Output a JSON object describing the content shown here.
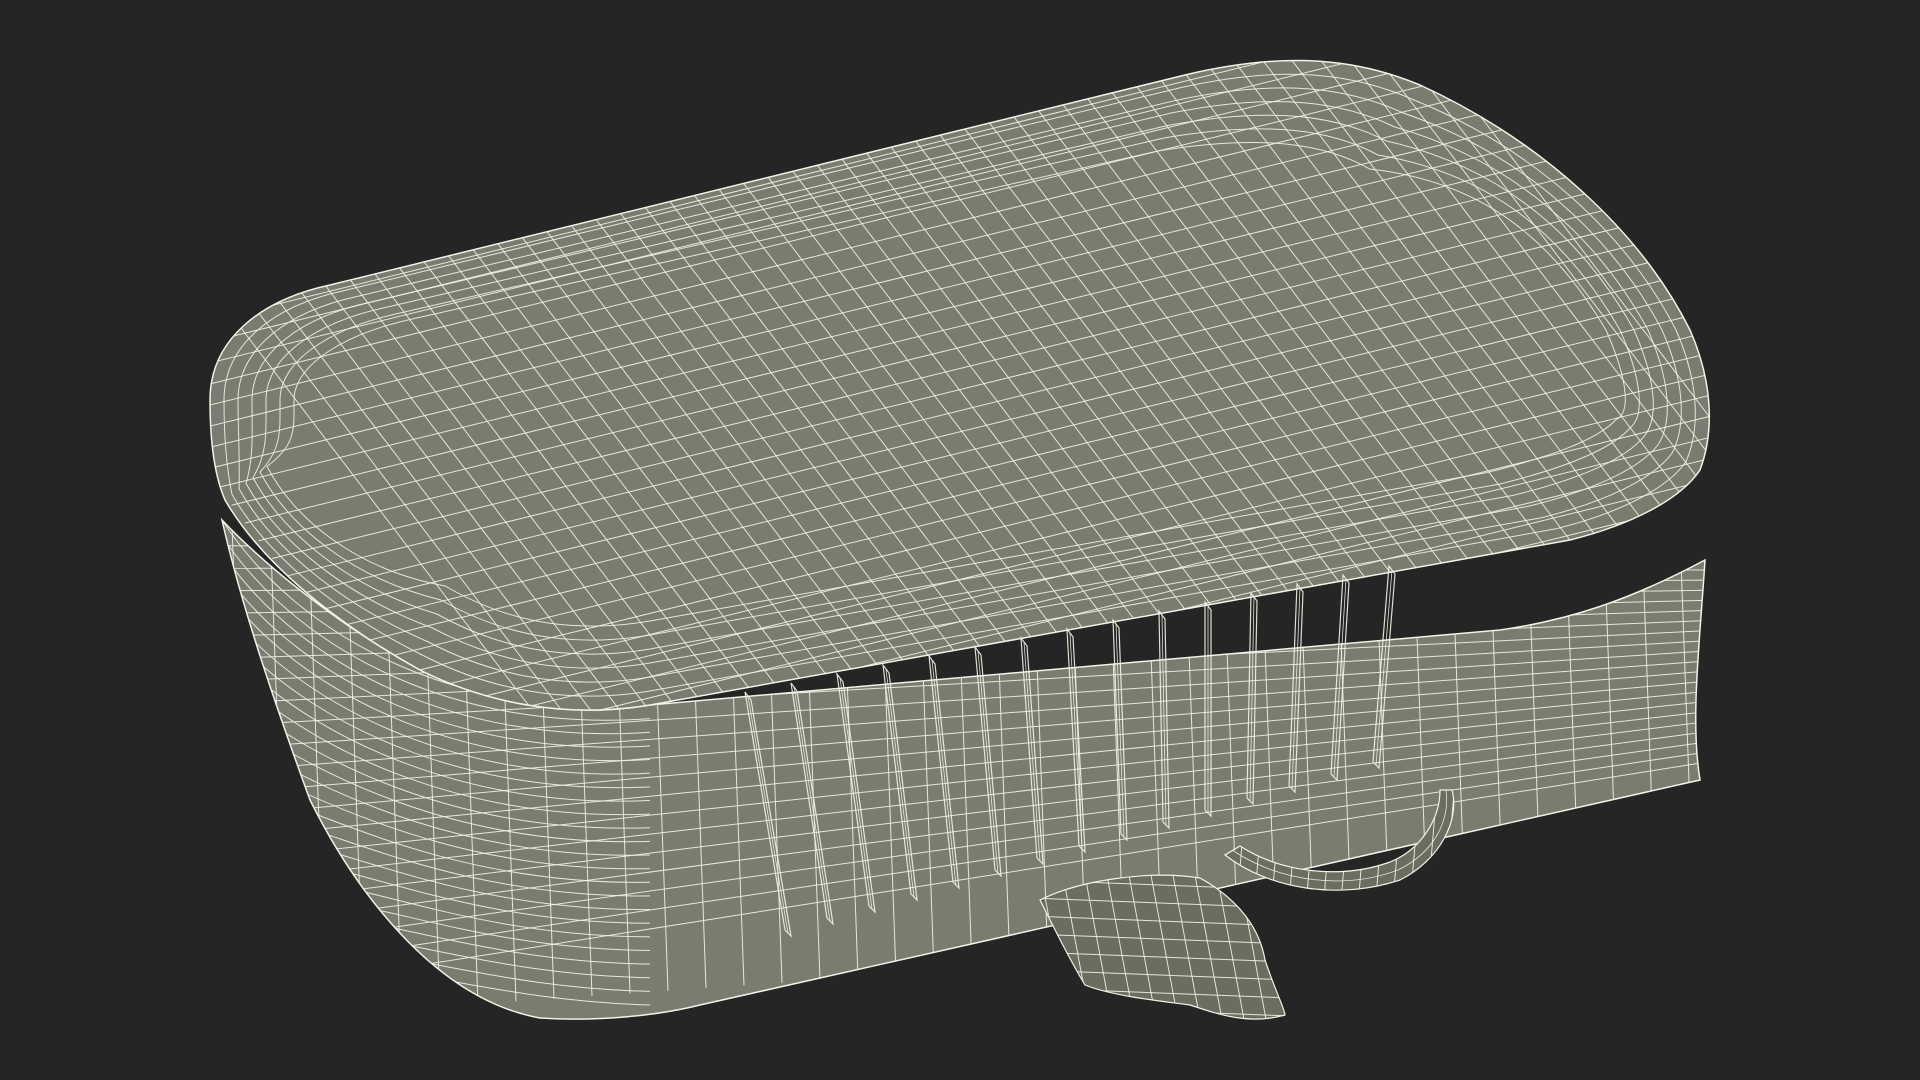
{
  "scene": {
    "background_color": "#252525",
    "mesh_fill_color": "#7b7c6f",
    "mesh_shadow_color": "#6c6d61",
    "wire_color": "#f2f3e6",
    "object": "wireframe-3d-model"
  }
}
